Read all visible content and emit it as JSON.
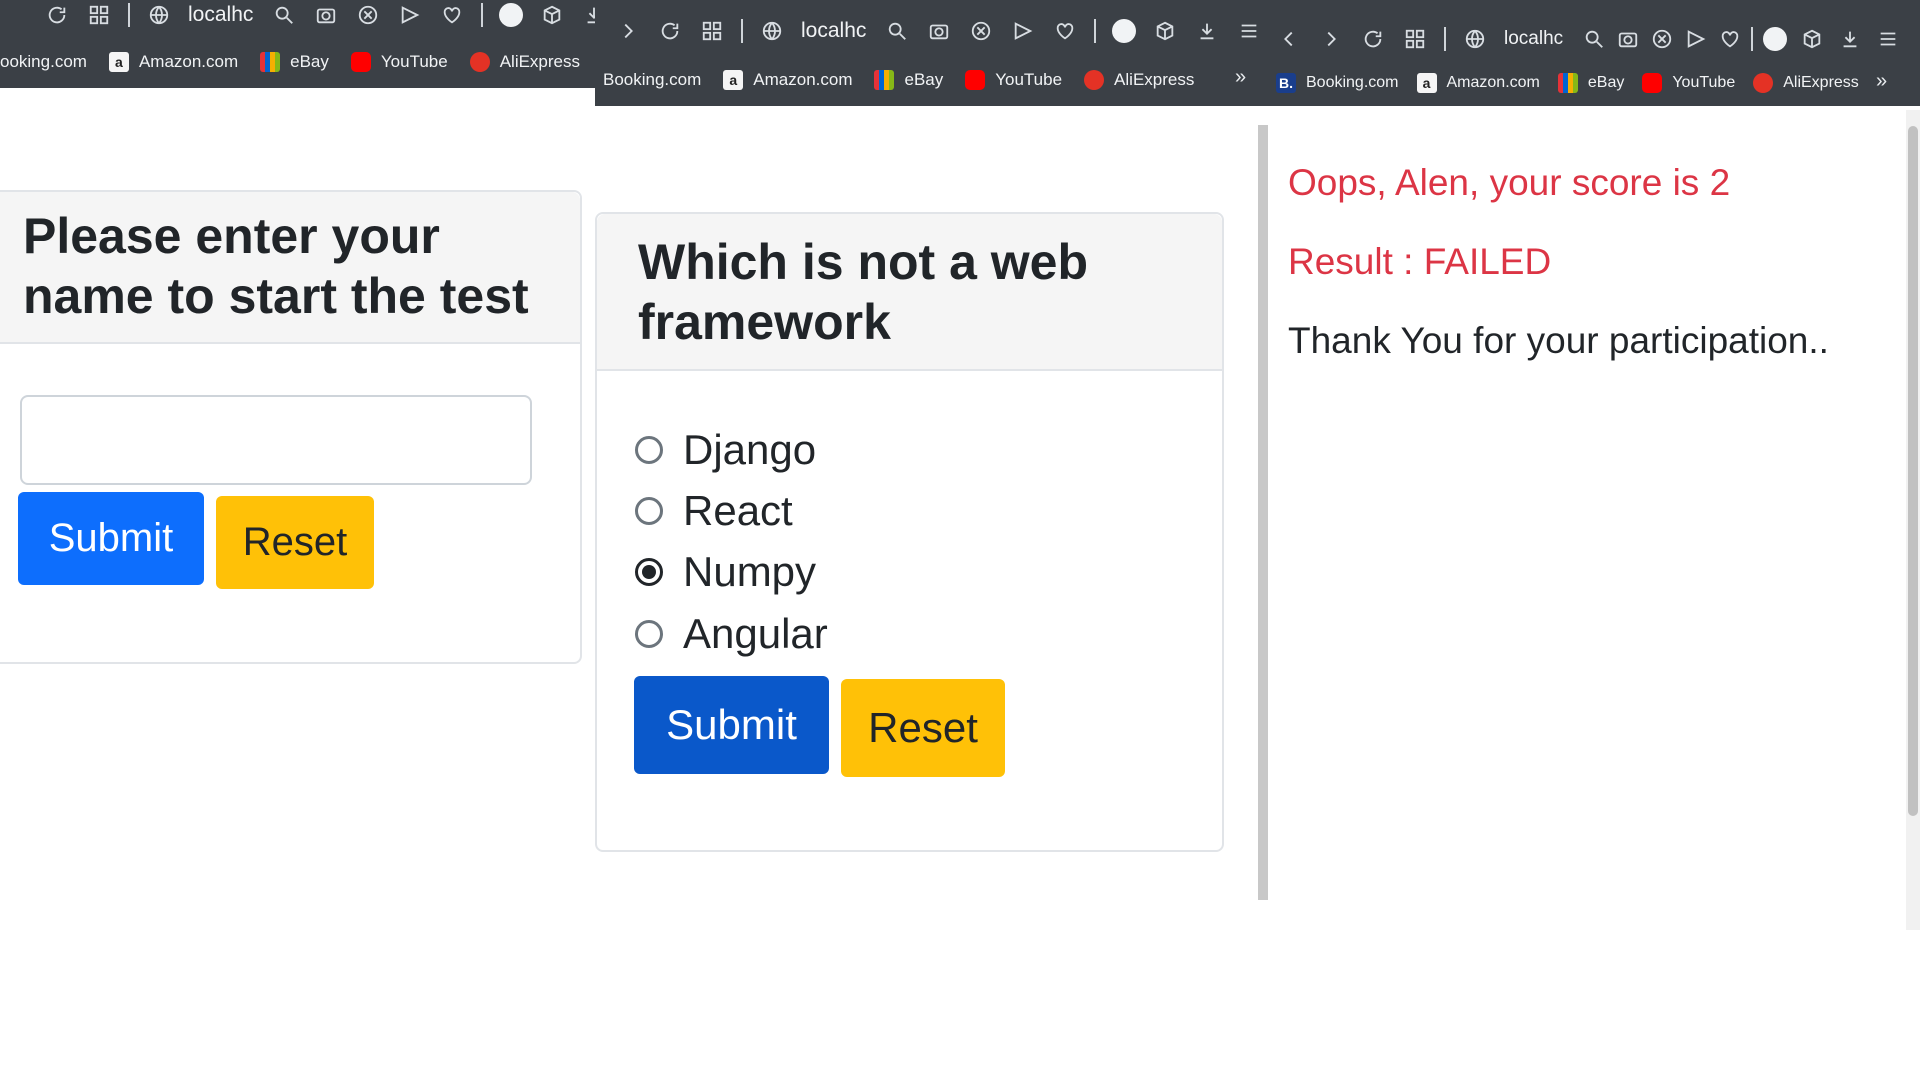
{
  "browser": {
    "address": "localhc",
    "bookmarks": [
      {
        "name": "Booking.com",
        "icon": "booking-icon",
        "icon_text": "B."
      },
      {
        "name": "Amazon.com",
        "icon": "amazon-icon",
        "icon_text": "a"
      },
      {
        "name": "eBay",
        "icon": "ebay-icon"
      },
      {
        "name": "YouTube",
        "icon": "youtube-icon"
      },
      {
        "name": "AliExpress",
        "icon": "aliexpress-icon"
      }
    ],
    "bookmarks_truncated_first": "ooking.com",
    "more_label": "»",
    "colors": {
      "chrome": "#3b4046"
    }
  },
  "pane1": {
    "title": "Please enter your name to start the test",
    "name_input": {
      "value": "",
      "placeholder": ""
    },
    "submit_label": "Submit",
    "reset_label": "Reset"
  },
  "pane2": {
    "question": "Which is not a web framework",
    "options": [
      "Django",
      "React",
      "Numpy",
      "Angular"
    ],
    "selected_option": "Numpy",
    "submit_label": "Submit",
    "reset_label": "Reset"
  },
  "pane3": {
    "score_text": "Oops, Alen, your score is 2",
    "result_text": "Result : FAILED",
    "thanks_text": "Thank You for your participation..",
    "colors": {
      "fail": "#dc3545",
      "text": "#212529"
    }
  },
  "colors": {
    "primary": "#0d6efd",
    "warning": "#ffc107"
  }
}
